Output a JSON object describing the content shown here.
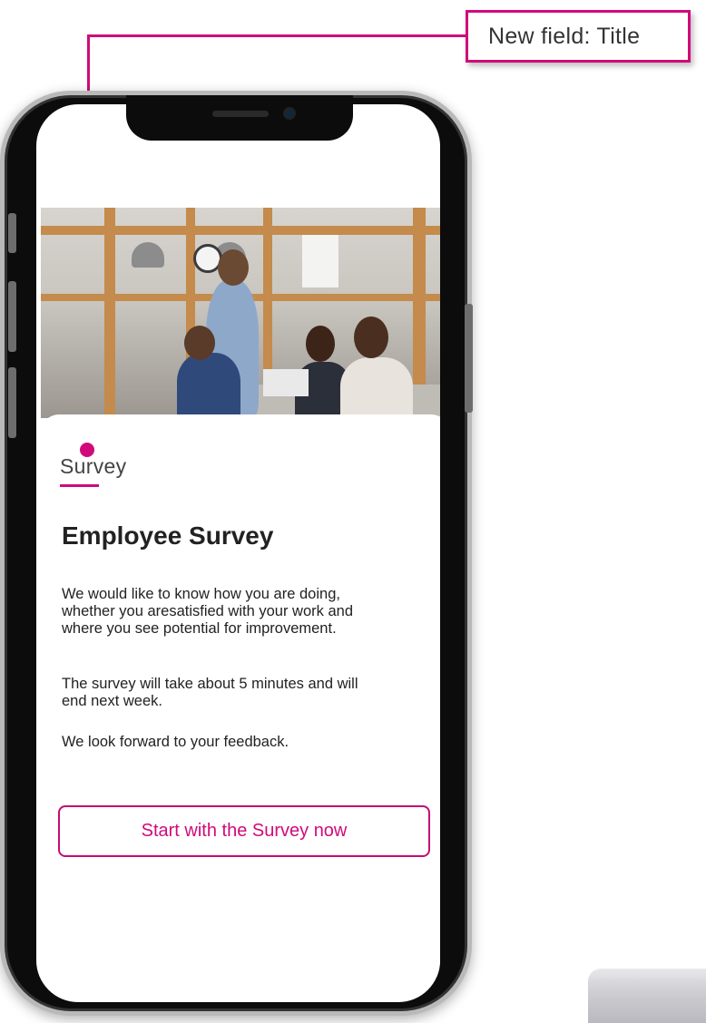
{
  "callout": {
    "label": "New field: Title"
  },
  "card": {
    "category": "Survey",
    "title": "Employee Survey",
    "paragraphs": [
      "We would like to know how you are doing, whether you aresatisfied with your work and where you see potential for improvement.",
      "The survey will take about 5 minutes and will end next week.",
      "We look forward to your feedback."
    ],
    "cta_label": "Start with the Survey now"
  },
  "colors": {
    "accent": "#d10a7a",
    "text": "#222222"
  },
  "hero_image": {
    "subject": "office-team-meeting-photo"
  }
}
